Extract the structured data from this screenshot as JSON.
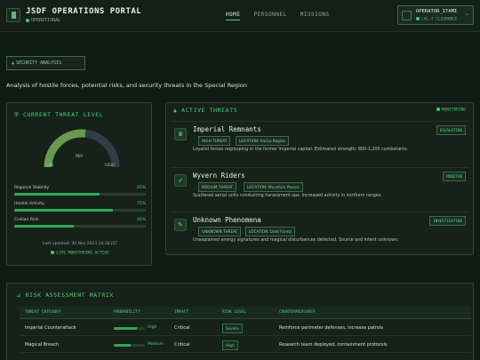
{
  "header": {
    "title": "JSDF OPERATIONS PORTAL",
    "status": "OPERATIONAL",
    "nav": [
      "HOME",
      "PERSONNEL",
      "MISSIONS"
    ],
    "user": {
      "name": "OPERATOR_ITAMI",
      "level": "LVL-3 CLEARANCE"
    }
  },
  "section_tag": "SECURITY ANALYSIS",
  "subtitle": "Analysis of hostile forces, potential risks, and security threats in the Special Region",
  "threat_level": {
    "title": "CURRENT THREAT LEVEL",
    "gauge": {
      "low": "LOW",
      "mid": "MED",
      "high": "HIGH"
    },
    "metrics": [
      {
        "label": "Regional Stability",
        "value": "65%",
        "fraction": 0.65
      },
      {
        "label": "Hostile Activity",
        "value": "75%",
        "fraction": 0.75
      },
      {
        "label": "Civilian Risk",
        "value": "45%",
        "fraction": 0.45
      }
    ],
    "updated": "Last updated: 30 Nov 2023 14:38 JST",
    "live": "LIVE MONITORING ACTIVE"
  },
  "active_threats": {
    "title": "ACTIVE THREATS",
    "monitor_label": "MONITORING",
    "items": [
      {
        "name": "Imperial Remnants",
        "threat": "HIGH THREAT",
        "location": "LOCATION: Italica Region",
        "desc": "Loyalist forces regrouping in the former imperial capital. Estimated strength: 800-1,200 combatants.",
        "status": "ESCALATING",
        "icon": "crown-icon"
      },
      {
        "name": "Wyvern Riders",
        "threat": "MEDIUM THREAT",
        "location": "LOCATION: Mountain Passes",
        "desc": "Scattered aerial units conducting harassment ops. Increased activity in northern ranges.",
        "status": "MONITOR",
        "icon": "dragon-icon"
      },
      {
        "name": "Unknown Phenomena",
        "threat": "UNKNOWN THREAT",
        "location": "LOCATION: Dark Forest",
        "desc": "Unexplained energy signatures and magical disturbances detected. Source and intent unknown.",
        "status": "INVESTIGATING",
        "icon": "wand-icon"
      }
    ]
  },
  "matrix": {
    "title": "RISK ASSESSMENT MATRIX",
    "columns": [
      "THREAT CATEGORY",
      "PROBABILITY",
      "IMPACT",
      "RISK LEVEL",
      "COUNTERMEASURES"
    ],
    "rows": [
      {
        "category": "Imperial Counterattack",
        "probability": "High",
        "prob_fraction": 0.75,
        "impact": "Critical",
        "risk": "Severe",
        "countermeasures": "Reinforce perimeter defenses, increase patrols"
      },
      {
        "category": "Magical Breach",
        "probability": "Medium",
        "prob_fraction": 0.55,
        "impact": "Critical",
        "risk": "High",
        "countermeasures": "Research team deployed, containment protocols"
      }
    ]
  },
  "colors": {
    "accent": "#4fd07a",
    "background": "#0f1a14",
    "panel": "#152119",
    "border": "#2e4536"
  }
}
